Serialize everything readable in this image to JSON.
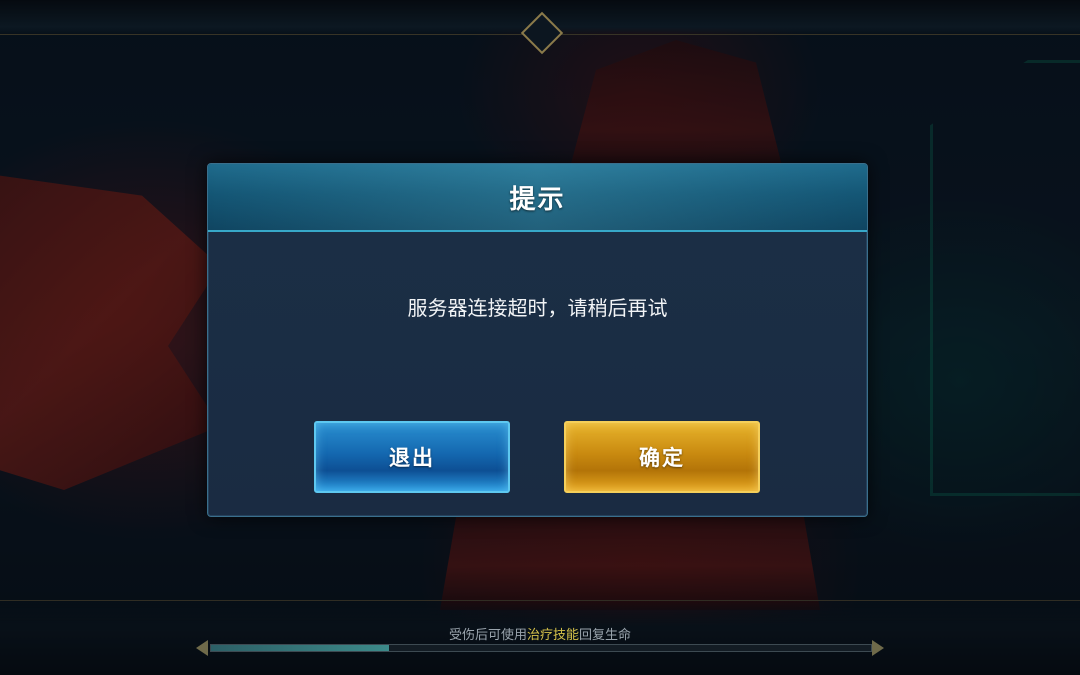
{
  "dialog": {
    "title": "提示",
    "message": "服务器连接超时，请稍后再试",
    "exit_label": "退出",
    "confirm_label": "确定"
  },
  "loading": {
    "tip_prefix": "受伤后可使用",
    "tip_highlight": "治疗技能",
    "tip_suffix": "回复生命",
    "progress": 0.27
  },
  "colors": {
    "exit_button": "#1468b0",
    "confirm_button": "#c98a10",
    "tip_highlight": "#d6c24a"
  }
}
